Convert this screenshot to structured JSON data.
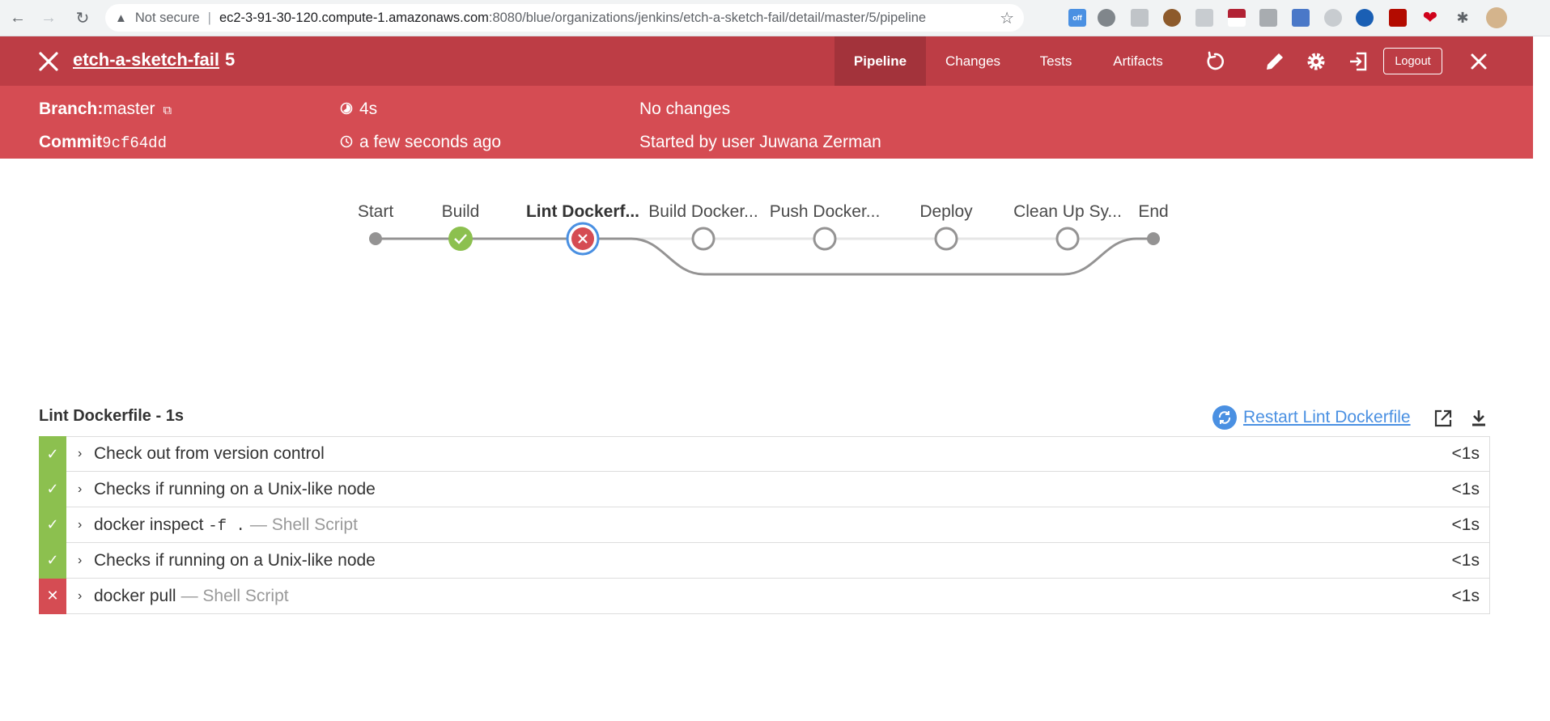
{
  "browser": {
    "security_label": "Not secure",
    "url_host": "ec2-3-91-30-120.compute-1.amazonaws.com",
    "url_path": ":8080/blue/organizations/jenkins/etch-a-sketch-fail/detail/master/5/pipeline",
    "ext_off_label": "off"
  },
  "header": {
    "job_name": "etch-a-sketch-fail",
    "run_number": "5",
    "tabs": [
      {
        "label": "Pipeline",
        "active": true
      },
      {
        "label": "Changes",
        "active": false
      },
      {
        "label": "Tests",
        "active": false
      },
      {
        "label": "Artifacts",
        "active": false
      }
    ],
    "logout_label": "Logout"
  },
  "run_info": {
    "branch_label": "Branch:",
    "branch_value": "master",
    "commit_label": "Commit",
    "commit_value": "9cf64dd",
    "duration": "4s",
    "started_ago": "a few seconds ago",
    "changes": "No changes",
    "started_by": "Started by user Juwana Zerman"
  },
  "pipeline": {
    "stages": [
      {
        "label": "Start",
        "status": "start"
      },
      {
        "label": "Build",
        "status": "success"
      },
      {
        "label": "Lint Dockerf...",
        "status": "failed",
        "selected": true
      },
      {
        "label": "Build Docker...",
        "status": "not_built"
      },
      {
        "label": "Push Docker...",
        "status": "not_built"
      },
      {
        "label": "Deploy",
        "status": "not_built"
      },
      {
        "label": "Clean Up Sy...",
        "status": "not_built"
      },
      {
        "label": "End",
        "status": "end"
      }
    ]
  },
  "steps_panel": {
    "title": "Lint Dockerfile - 1s",
    "restart_label": "Restart Lint Dockerfile",
    "steps": [
      {
        "status": "success",
        "text": "Check out from version control",
        "code": "",
        "sub": "",
        "duration": "<1s"
      },
      {
        "status": "success",
        "text": "Checks if running on a Unix-like node",
        "code": "",
        "sub": "",
        "duration": "<1s"
      },
      {
        "status": "success",
        "text": "docker inspect ",
        "code": "-f .",
        "sub": "— Shell Script",
        "duration": "<1s"
      },
      {
        "status": "success",
        "text": "Checks if running on a Unix-like node",
        "code": "",
        "sub": "",
        "duration": "<1s"
      },
      {
        "status": "failed",
        "text": "docker pull",
        "code": "",
        "sub": "— Shell Script",
        "duration": "<1s"
      }
    ]
  },
  "colors": {
    "header_dark": "#bd3d45",
    "header_light": "#d54c53",
    "success": "#8cc04f",
    "failed": "#d54c53",
    "link": "#4a90e2"
  }
}
